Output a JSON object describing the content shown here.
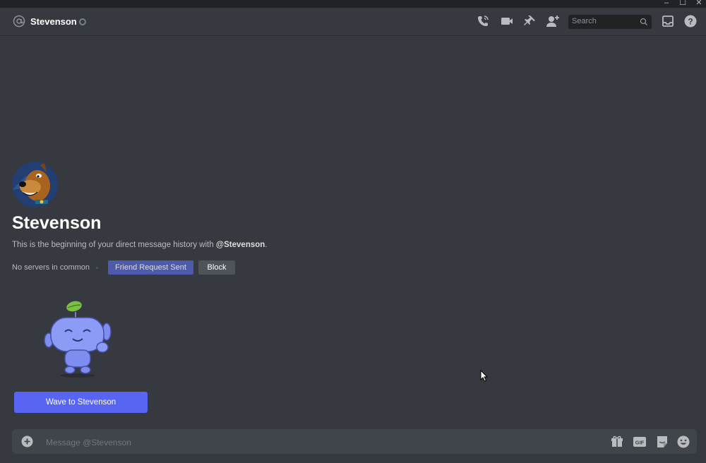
{
  "window": {
    "controls": [
      "–",
      "☐",
      "✕"
    ]
  },
  "header": {
    "channel_name": "Stevenson",
    "search_placeholder": "Search",
    "icons": [
      "at-icon",
      "call-icon",
      "video-icon",
      "pin-icon",
      "add-friend-icon",
      "search-icon",
      "inbox-icon",
      "help-icon"
    ]
  },
  "intro": {
    "name": "Stevenson",
    "text_prefix": "This is the beginning of your direct message history with ",
    "mention": "@Stevenson",
    "text_suffix": ".",
    "no_servers": "No servers in common",
    "friend_request_button": "Friend Request Sent",
    "block_button": "Block",
    "wave_button": "Wave to Stevenson"
  },
  "composer": {
    "placeholder": "Message @Stevenson",
    "icons": [
      "add-attachment-icon",
      "gift-icon",
      "gif-icon",
      "sticker-icon",
      "emoji-icon"
    ]
  },
  "colors": {
    "background": "#36393f",
    "accent": "#5865f2",
    "muted_accent": "#4e5aab"
  }
}
